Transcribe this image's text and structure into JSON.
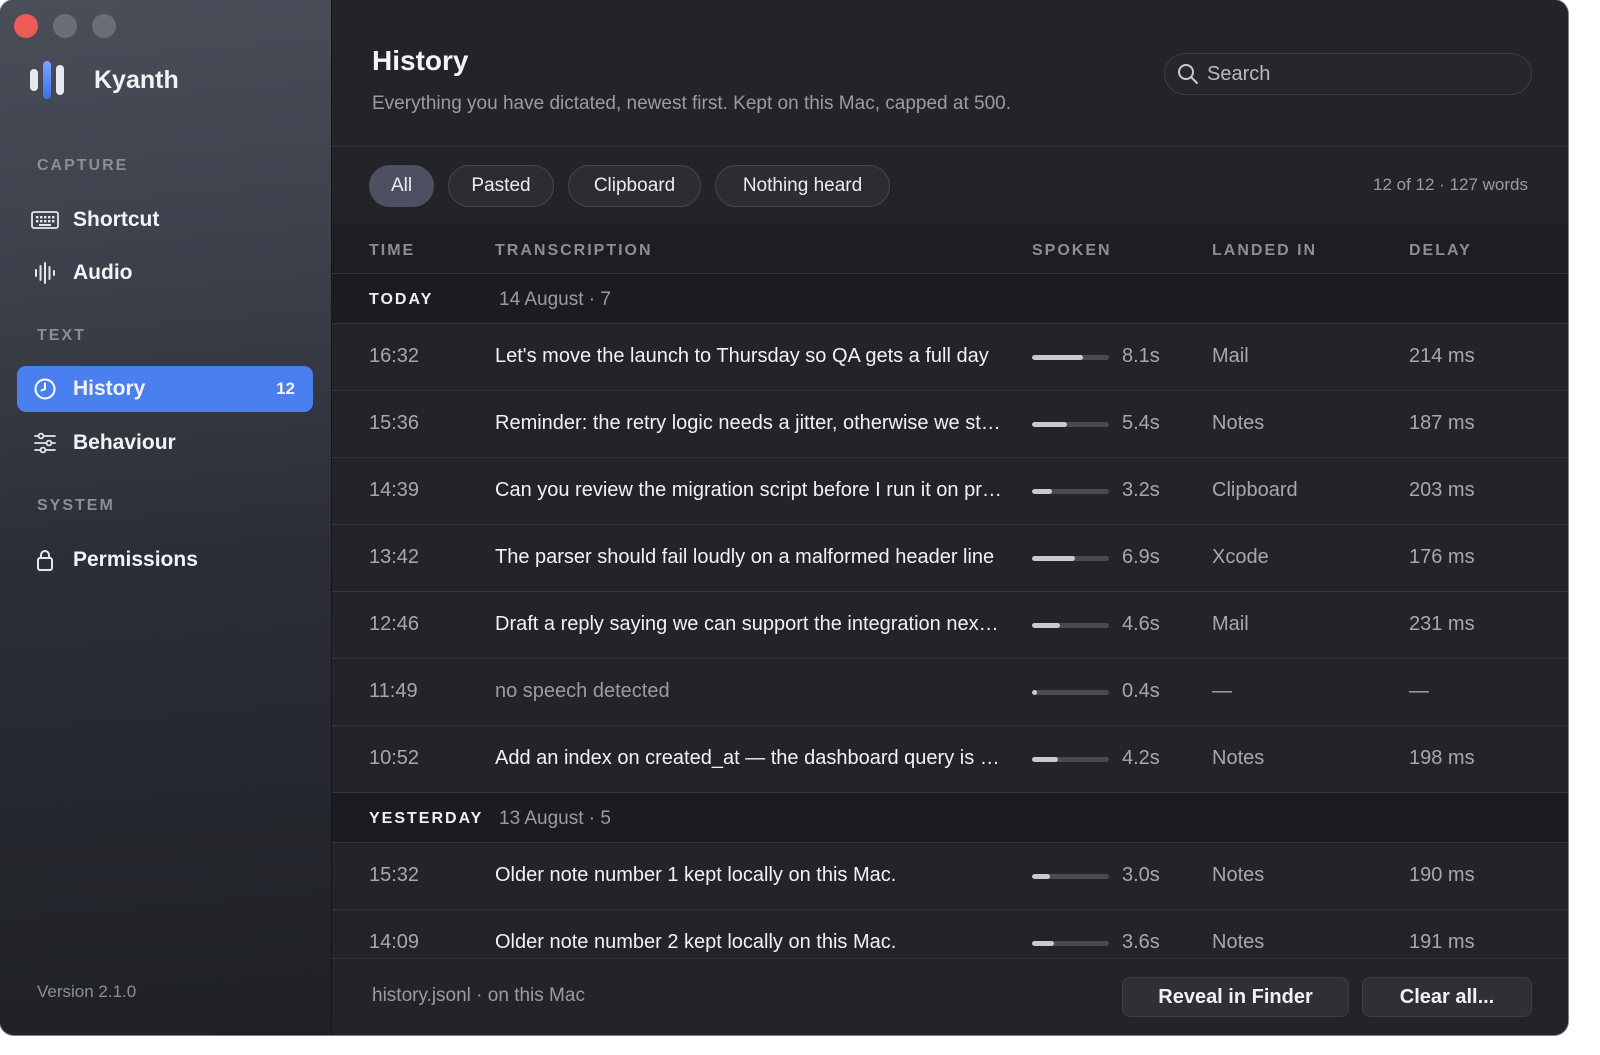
{
  "app": {
    "name": "Kyanth",
    "version": "Version 2.1.0"
  },
  "sidebar": {
    "sections": [
      {
        "label": "CAPTURE",
        "items": [
          {
            "label": "Shortcut",
            "icon": "keyboard-icon"
          },
          {
            "label": "Audio",
            "icon": "waveform-icon"
          }
        ]
      },
      {
        "label": "TEXT",
        "items": [
          {
            "label": "History",
            "icon": "clock-icon",
            "badge": "12",
            "active": true
          },
          {
            "label": "Behaviour",
            "icon": "sliders-icon"
          }
        ]
      },
      {
        "label": "SYSTEM",
        "items": [
          {
            "label": "Permissions",
            "icon": "lock-icon"
          }
        ]
      }
    ]
  },
  "header": {
    "title": "History",
    "subtitle": "Everything you have dictated, newest first. Kept on this Mac, capped at 500.",
    "search_placeholder": "Search"
  },
  "filters": {
    "chips": [
      "All",
      "Pasted",
      "Clipboard",
      "Nothing heard"
    ],
    "active": "All",
    "count": "12 of 12 · 127 words"
  },
  "table": {
    "columns": [
      "TIME",
      "TRANSCRIPTION",
      "SPOKEN",
      "LANDED IN",
      "DELAY"
    ],
    "groups": [
      {
        "name": "TODAY",
        "date": "14 August · 7",
        "rows": [
          {
            "time": "16:32",
            "text": "Let's move the launch to Thursday so QA gets a full day",
            "spoken": "8.1s",
            "fraction": 0.66,
            "app": "Mail",
            "delay": "214 ms"
          },
          {
            "time": "15:36",
            "text": "Reminder: the retry logic needs a jitter, otherwise we stampede",
            "spoken": "5.4s",
            "fraction": 0.45,
            "app": "Notes",
            "delay": "187 ms"
          },
          {
            "time": "14:39",
            "text": "Can you review the migration script before I run it on prod",
            "spoken": "3.2s",
            "fraction": 0.26,
            "app": "Clipboard",
            "delay": "203 ms"
          },
          {
            "time": "13:42",
            "text": "The parser should fail loudly on a malformed header line",
            "spoken": "6.9s",
            "fraction": 0.56,
            "app": "Xcode",
            "delay": "176 ms"
          },
          {
            "time": "12:46",
            "text": "Draft a reply saying we can support the integration next quarter",
            "spoken": "4.6s",
            "fraction": 0.37,
            "app": "Mail",
            "delay": "231 ms"
          },
          {
            "time": "11:49",
            "text": "no speech detected",
            "muted": true,
            "spoken": "0.4s",
            "fraction": 0.05,
            "app": "—",
            "delay": "—"
          },
          {
            "time": "10:52",
            "text": "Add an index on created_at — the dashboard query is slow",
            "spoken": "4.2s",
            "fraction": 0.34,
            "app": "Notes",
            "delay": "198 ms"
          }
        ]
      },
      {
        "name": "YESTERDAY",
        "date": "13 August · 5",
        "rows": [
          {
            "time": "15:32",
            "text": "Older note number 1 kept locally on this Mac.",
            "spoken": "3.0s",
            "fraction": 0.24,
            "app": "Notes",
            "delay": "190 ms"
          },
          {
            "time": "14:09",
            "text": "Older note number 2 kept locally on this Mac.",
            "spoken": "3.6s",
            "fraction": 0.29,
            "app": "Notes",
            "delay": "191 ms"
          }
        ]
      }
    ]
  },
  "footer": {
    "note": "history.jsonl · on this Mac",
    "reveal_label": "Reveal in Finder",
    "clear_label": "Clear all..."
  }
}
